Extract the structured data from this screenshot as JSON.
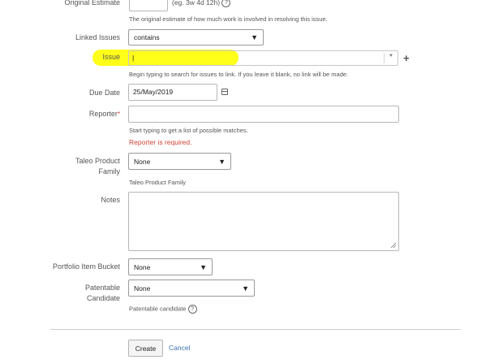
{
  "original_estimate": {
    "label": "Original Estimate",
    "example": "(eg. 3w 4d 12h)",
    "help_glyph": "?",
    "description": "The original estimate of how much work is involved in resolving this issue."
  },
  "linked_issues": {
    "label": "Linked Issues",
    "selected": "contains"
  },
  "issue": {
    "label": "Issue",
    "value": "|",
    "add_glyph": "+",
    "description": "Begin typing to search for issues to link. If you leave it blank, no link will be made.",
    "highlight_color": "#ffff00"
  },
  "due_date": {
    "label": "Due Date",
    "value": "25/May/2019"
  },
  "reporter": {
    "label": "Reporter",
    "required_mark": "*",
    "description": "Start typing to get a list of possible matches.",
    "error": "Reporter is required."
  },
  "taleo": {
    "label_line1": "Taleo Product",
    "label_line2": "Family",
    "selected": "None",
    "description": "Taleo Product Family"
  },
  "notes": {
    "label": "Notes"
  },
  "portfolio": {
    "label": "Portfolio Item Bucket",
    "selected": "None"
  },
  "patentable": {
    "label_line1": "Patentable",
    "label_line2": "Candidate",
    "selected": "None",
    "description": "Patentable candidate",
    "help_glyph": "?"
  },
  "actions": {
    "create": "Create",
    "cancel": "Cancel"
  }
}
